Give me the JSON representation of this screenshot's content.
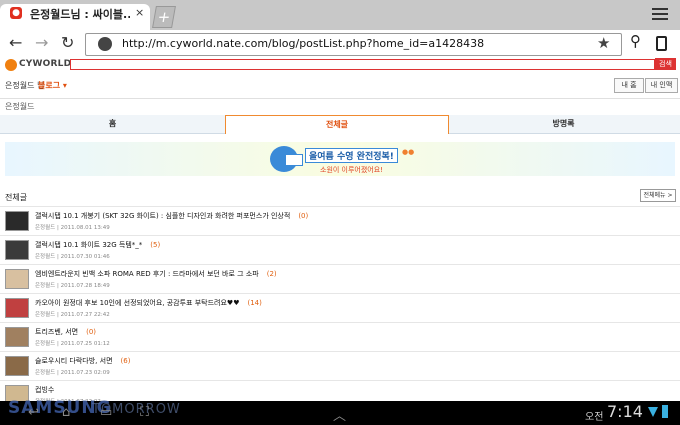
{
  "browser": {
    "tab_title": "은정월드님 : 싸이블...",
    "tab_close": "×",
    "new_tab": "+",
    "back": "←",
    "forward": "→",
    "refresh": "↻",
    "url": "http://m.cyworld.nate.com/blog/postList.php?home_id=a1428438",
    "star": "★",
    "search": "⚲"
  },
  "site": {
    "logo_text": "CYWORLD",
    "search_button": "검색",
    "user_name": "은정월드 님",
    "blog_link": "블로그 ▾",
    "my_home": "내 홈",
    "my_info": "내 인맥"
  },
  "blog": {
    "owner": "은정월드",
    "tabs": [
      "홈",
      "전체글",
      "방명록"
    ],
    "active_tab": "전체글"
  },
  "banner": {
    "title": "올여름 수영 완전정복!",
    "subtitle": "소원이 이루어졌어요!",
    "dots": "●●"
  },
  "posts_section": {
    "label": "전체글",
    "menu_button": "전체메뉴 >"
  },
  "posts": [
    {
      "title": "갤럭시탭 10.1 개봉기 (SKT 32G 화이트) : 심플한 디자인과 화려한 퍼포먼스가 인상적",
      "count": "(0)",
      "author": "은정월드",
      "date": "2011.08.01 13:49"
    },
    {
      "title": "갤럭시탭 10.1 화이트 32G 득템*_*",
      "count": "(5)",
      "author": "은정월드",
      "date": "2011.07.30 01:46"
    },
    {
      "title": "엠비엔트라운지 빈백 소파 ROMA RED 후기 : 드라마에서 보던 바로 그 소파",
      "count": "(2)",
      "author": "은정월드",
      "date": "2011.07.28 18:49"
    },
    {
      "title": "카오아이 원정대 후보 10인에 선정되었어요, 공감투표 부탁드려요♥♥",
      "count": "(14)",
      "author": "은정월드",
      "date": "2011.07.27 22:42"
    },
    {
      "title": "트리즈벤, 서면",
      "count": "(0)",
      "author": "은정월드",
      "date": "2011.07.25 01:12"
    },
    {
      "title": "슬로우시티 다락다방, 서면",
      "count": "(6)",
      "author": "은정월드",
      "date": "2011.07.23 02:09"
    },
    {
      "title": "컵빙수",
      "count": "",
      "author": "은정월드",
      "date": "2011.07.22 02:..."
    }
  ],
  "system": {
    "watermark": "SAMSUNG",
    "watermark2": "TOMORROW",
    "ampm": "오전",
    "time": "7:14",
    "nav_back": "↩",
    "nav_home": "⌂",
    "nav_recent": "▭",
    "nav_up": "︿"
  }
}
